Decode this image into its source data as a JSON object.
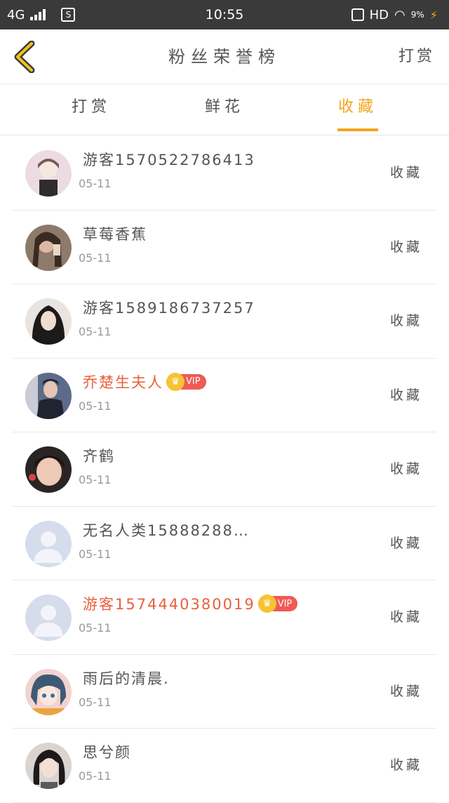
{
  "status_bar": {
    "network": "4G",
    "time": "10:55",
    "hd": "HD",
    "battery": "9%"
  },
  "header": {
    "title": "粉丝荣誉榜",
    "action": "打赏",
    "back_icon": "chevron-left-icon",
    "accent_color": "#f4a51c"
  },
  "tabs": [
    {
      "label": "打赏",
      "active": false
    },
    {
      "label": "鲜花",
      "active": false
    },
    {
      "label": "收藏",
      "active": true
    }
  ],
  "list": [
    {
      "name": "游客1570522786413",
      "date": "05-11",
      "action": "收藏",
      "vip": false,
      "vip_label": ""
    },
    {
      "name": "草莓香蕉",
      "date": "05-11",
      "action": "收藏",
      "vip": false,
      "vip_label": ""
    },
    {
      "name": "游客1589186737257",
      "date": "05-11",
      "action": "收藏",
      "vip": false,
      "vip_label": ""
    },
    {
      "name": "乔楚生夫人",
      "date": "05-11",
      "action": "收藏",
      "vip": true,
      "vip_label": "VIP"
    },
    {
      "name": "齐鹤",
      "date": "05-11",
      "action": "收藏",
      "vip": false,
      "vip_label": ""
    },
    {
      "name": "无名人类15888288…",
      "date": "05-11",
      "action": "收藏",
      "vip": false,
      "vip_label": ""
    },
    {
      "name": "游客1574440380019",
      "date": "05-11",
      "action": "收藏",
      "vip": true,
      "vip_label": "VIP"
    },
    {
      "name": "雨后的清晨.",
      "date": "05-11",
      "action": "收藏",
      "vip": false,
      "vip_label": ""
    },
    {
      "name": "思兮颜",
      "date": "05-11",
      "action": "收藏",
      "vip": false,
      "vip_label": ""
    }
  ]
}
